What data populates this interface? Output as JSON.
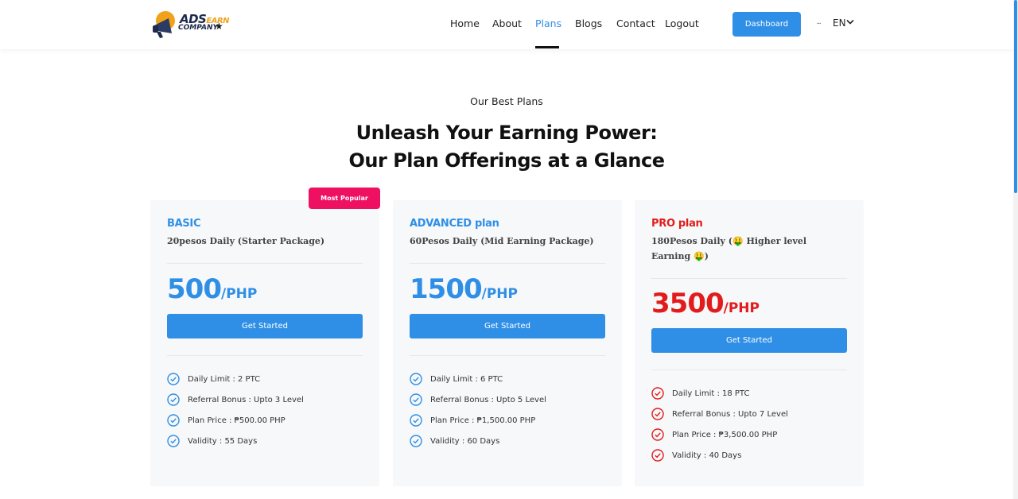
{
  "logo": {
    "line1": "ADS",
    "line1_accent": "EARN",
    "line2": "COMPANY",
    "star": "★"
  },
  "nav": {
    "items": [
      {
        "label": "Home"
      },
      {
        "label": "About"
      },
      {
        "label": "Plans",
        "active": true
      },
      {
        "label": "Blogs"
      },
      {
        "label": "Contact"
      },
      {
        "label": "Logout"
      }
    ],
    "dashboard_label": "Dashboard",
    "language": "EN"
  },
  "section": {
    "eyebrow": "Our Best Plans",
    "title_line1": "Unleash Your Earning Power:",
    "title_line2": "Our Plan Offerings at a Glance"
  },
  "plans": [
    {
      "badge": "Most Popular",
      "name": "BASIC",
      "description": "20pesos Daily (Starter Package)",
      "price": "500",
      "unit": "/PHP",
      "cta": "Get Started",
      "accent": "#2f8fe6",
      "features": [
        "Daily Limit : 2 PTC",
        "Referral Bonus : Upto 3 Level",
        "Plan Price : ₱500.00 PHP",
        "Validity : 55 Days"
      ]
    },
    {
      "name": "ADVANCED plan",
      "description": "60Pesos Daily (Mid Earning Package)",
      "price": "1500",
      "unit": "/PHP",
      "cta": "Get Started",
      "accent": "#2f8fe6",
      "features": [
        "Daily Limit : 6 PTC",
        "Referral Bonus : Upto 5 Level",
        "Plan Price : ₱1,500.00 PHP",
        "Validity : 60 Days"
      ]
    },
    {
      "name": "PRO plan",
      "description": "180Pesos Daily (🤑 Higher level Earning 🤑)",
      "price": "3500",
      "unit": "/PHP",
      "cta": "Get Started",
      "accent": "#e21c1c",
      "features": [
        "Daily Limit : 18 PTC",
        "Referral Bonus : Upto 7 Level",
        "Plan Price : ₱3,500.00 PHP",
        "Validity : 40 Days"
      ]
    }
  ],
  "icons": {
    "check": "check-circle-icon",
    "chevron": "chevron-down-icon",
    "megaphone": "megaphone-icon"
  }
}
